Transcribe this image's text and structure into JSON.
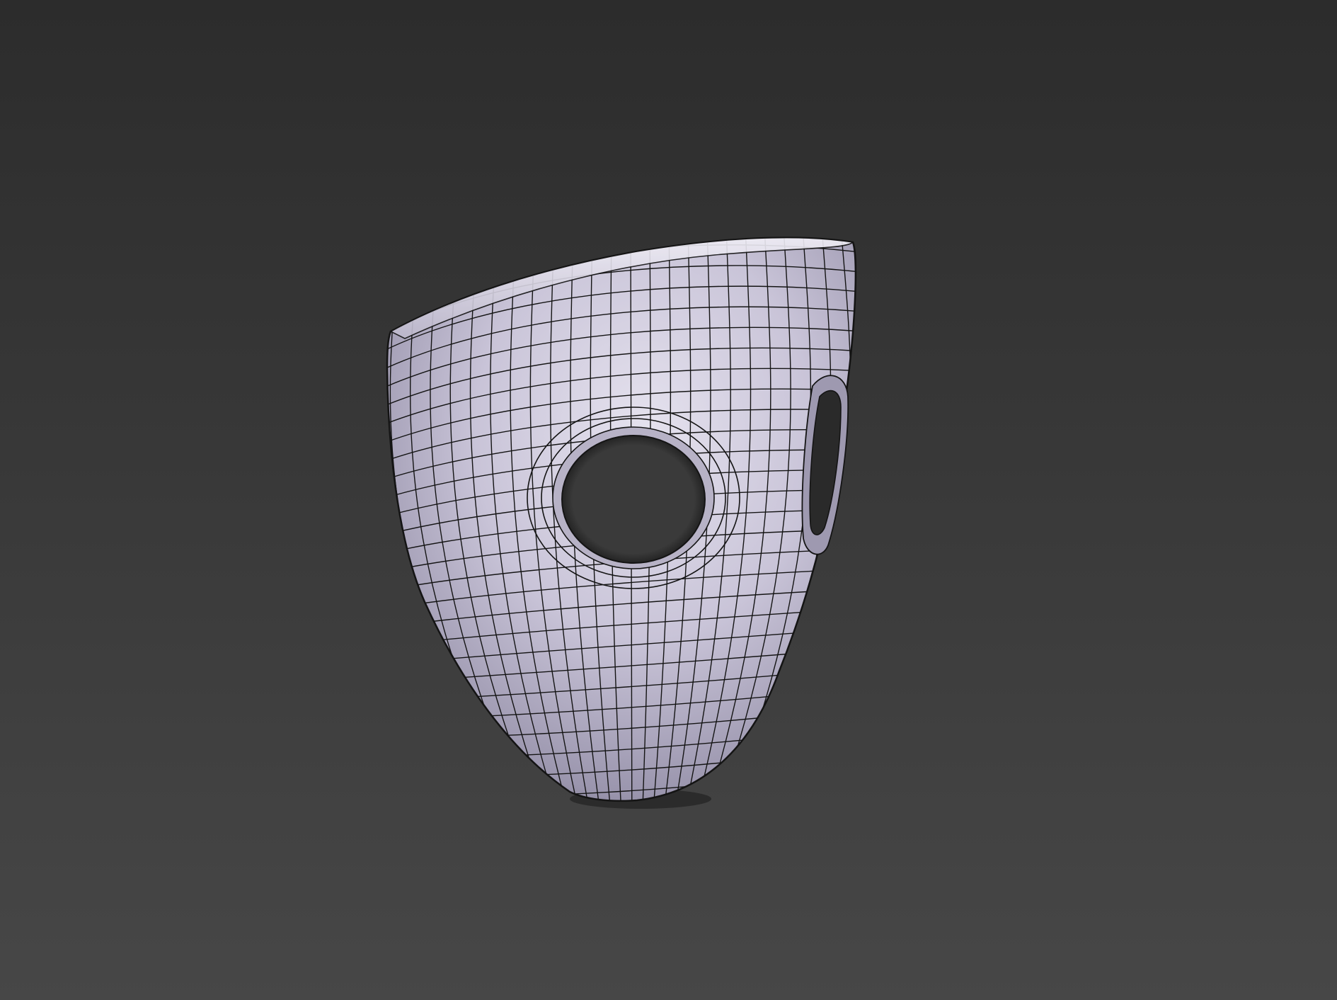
{
  "viewport": {
    "background_top": "#2c2c2c",
    "background_bottom": "#474747",
    "shading_mode": "smooth-with-wireframe"
  },
  "model": {
    "surface_color": "#c8c3d6",
    "surface_shadow": "#6e6a80",
    "surface_highlight": "#e4e1ee",
    "wire_color": "#141414",
    "features": [
      "front-hole",
      "side-slot"
    ]
  }
}
